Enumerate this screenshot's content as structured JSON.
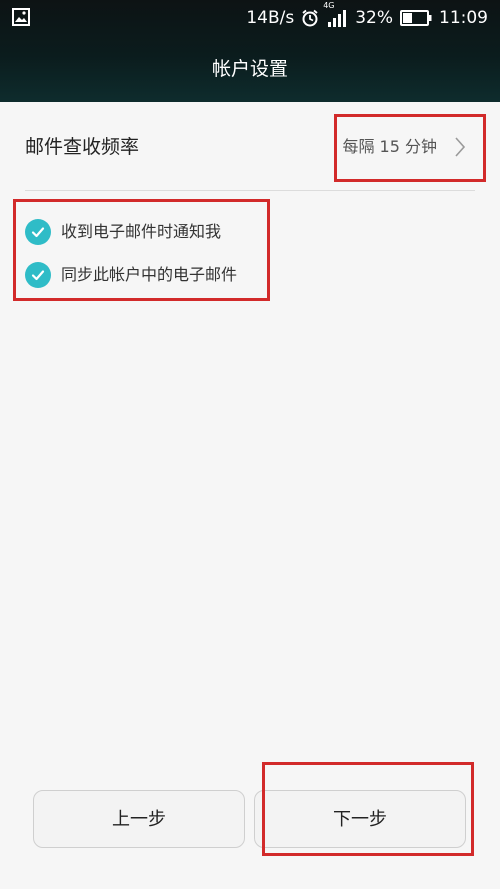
{
  "status_bar": {
    "speed": "14B/s",
    "network": "4G",
    "battery": "32%",
    "time": "11:09",
    "icons": [
      "image-icon",
      "alarm-icon",
      "signal-icon",
      "battery-icon"
    ]
  },
  "header": {
    "title": "帐户设置"
  },
  "settings": {
    "frequency_label": "邮件查收频率",
    "frequency_value": "每隔 15 分钟",
    "options": [
      {
        "label": "收到电子邮件时通知我",
        "checked": true
      },
      {
        "label": "同步此帐户中的电子邮件",
        "checked": true
      }
    ]
  },
  "buttons": {
    "prev": "上一步",
    "next": "下一步"
  },
  "colors": {
    "accent": "#2fbcc7",
    "highlight": "#d22a2a",
    "header_bg": "#0d1b1c"
  }
}
